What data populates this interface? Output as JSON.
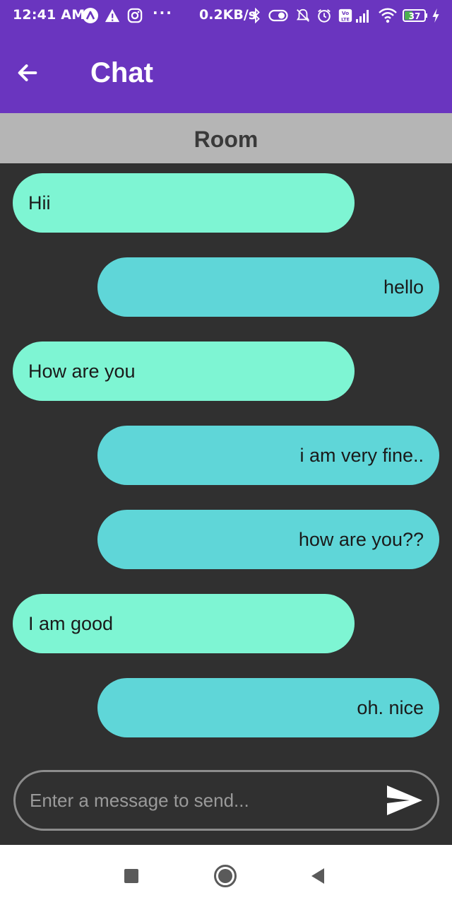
{
  "status_bar": {
    "time": "12:41 AM",
    "network_speed": "0.2KB/s",
    "battery_level": "37",
    "icons": [
      "arc-app-icon",
      "warning-icon",
      "instagram-icon",
      "more-dots-icon",
      "bluetooth-icon",
      "toggle-icon",
      "alarm-off-icon",
      "alarm-icon",
      "volte-icon",
      "signal-icon",
      "wifi-icon",
      "battery-icon",
      "charging-icon"
    ]
  },
  "app_bar": {
    "title": "Chat",
    "back_icon": "arrow-left-icon"
  },
  "room": {
    "title": "Room"
  },
  "messages": [
    {
      "text": "Hii",
      "direction": "received"
    },
    {
      "text": "hello",
      "direction": "sent"
    },
    {
      "text": "How are you",
      "direction": "received"
    },
    {
      "text": "i am very fine..",
      "direction": "sent"
    },
    {
      "text": "how are you??",
      "direction": "sent"
    },
    {
      "text": "I am good",
      "direction": "received"
    },
    {
      "text": "oh. nice",
      "direction": "sent"
    }
  ],
  "composer": {
    "placeholder": "Enter a message to send...",
    "value": "",
    "send_icon": "send-icon"
  },
  "nav_bar": {
    "icons": [
      "recents-icon",
      "home-icon",
      "back-icon"
    ]
  },
  "colors": {
    "app_bar": "#6a35bf",
    "room_header": "#b5b5b5",
    "chat_background": "#303030",
    "received_bubble": "#7ef5d3",
    "sent_bubble": "#5fd6d8"
  }
}
